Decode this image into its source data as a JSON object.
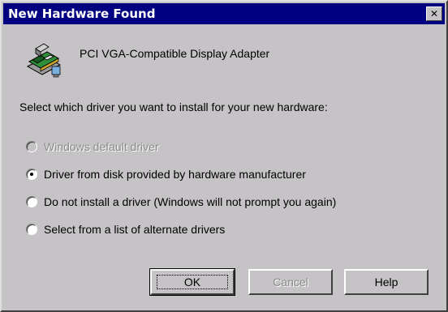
{
  "window": {
    "title": "New Hardware Found",
    "close_label": "✕"
  },
  "device": {
    "icon": "network-card-icon",
    "name": "PCI VGA-Compatible Display Adapter"
  },
  "prompt": "Select which driver you want to install for your new hardware:",
  "options": [
    {
      "label": "Windows default driver",
      "selected": false,
      "enabled": false
    },
    {
      "label": "Driver from disk provided by hardware manufacturer",
      "selected": true,
      "enabled": true
    },
    {
      "label": "Do not install a driver (Windows will not prompt you again)",
      "selected": false,
      "enabled": true
    },
    {
      "label": "Select from a list of alternate drivers",
      "selected": false,
      "enabled": true
    }
  ],
  "buttons": {
    "ok": "OK",
    "cancel": "Cancel",
    "help": "Help"
  },
  "colors": {
    "titlebar": "#000080",
    "face": "#c6c3c6"
  }
}
